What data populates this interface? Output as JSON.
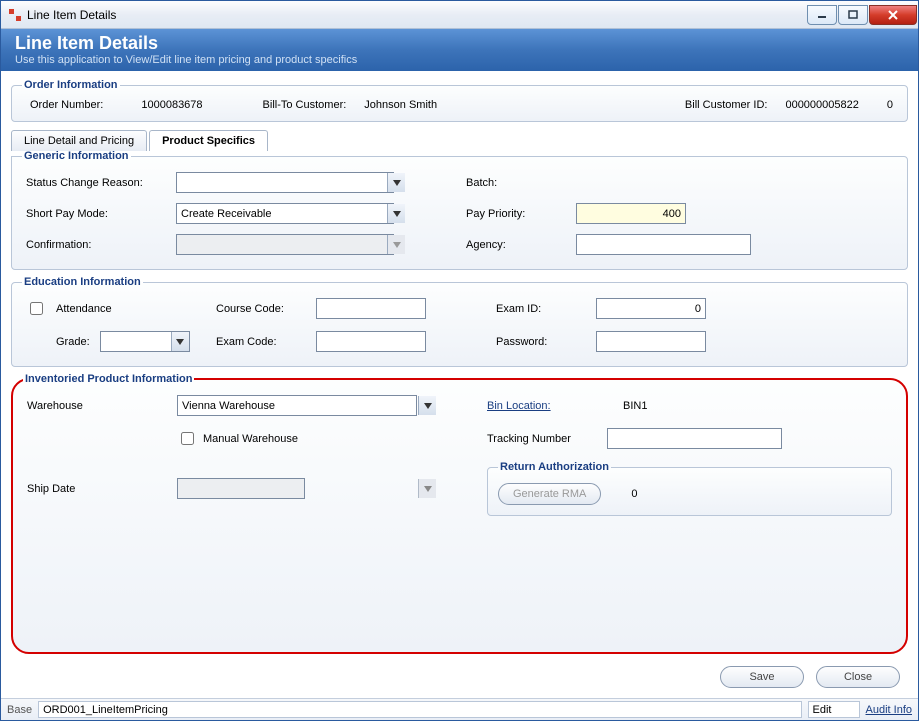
{
  "window": {
    "title": "Line Item Details"
  },
  "banner": {
    "title": "Line Item Details",
    "subtitle": "Use this application to View/Edit line item pricing and product specifics"
  },
  "order": {
    "legend": "Order Information",
    "order_number_label": "Order Number:",
    "order_number": "1000083678",
    "bill_to_label": "Bill-To Customer:",
    "bill_to": "Johnson Smith",
    "bill_customer_id_label": "Bill Customer ID:",
    "bill_customer_id": "000000005822",
    "bill_customer_sub": "0"
  },
  "tabs": {
    "line_detail": "Line Detail and Pricing",
    "product_specifics": "Product Specifics"
  },
  "generic": {
    "legend": "Generic Information",
    "status_change_reason_label": "Status Change Reason:",
    "status_change_reason": "",
    "short_pay_mode_label": "Short Pay Mode:",
    "short_pay_mode": "Create Receivable",
    "confirmation_label": "Confirmation:",
    "confirmation": "",
    "batch_label": "Batch:",
    "batch": "",
    "pay_priority_label": "Pay Priority:",
    "pay_priority": "400",
    "agency_label": "Agency:",
    "agency": ""
  },
  "education": {
    "legend": "Education Information",
    "attendance_label": "Attendance",
    "attendance": false,
    "grade_label": "Grade:",
    "grade": "",
    "course_code_label": "Course Code:",
    "course_code": "",
    "exam_code_label": "Exam Code:",
    "exam_code": "",
    "exam_id_label": "Exam ID:",
    "exam_id": "0",
    "password_label": "Password:",
    "password": ""
  },
  "inventory": {
    "legend": "Inventoried Product Information",
    "warehouse_label": "Warehouse",
    "warehouse": "Vienna Warehouse",
    "manual_warehouse_label": "Manual Warehouse",
    "manual_warehouse": false,
    "ship_date_label": "Ship Date",
    "ship_date": "",
    "bin_location_label": "Bin Location:",
    "bin_location": "BIN1",
    "tracking_number_label": "Tracking Number",
    "tracking_number": "",
    "return_auth_legend": "Return Authorization",
    "generate_rma_label": "Generate RMA",
    "rma_value": "0"
  },
  "buttons": {
    "save": "Save",
    "close": "Close"
  },
  "statusbar": {
    "base": "Base",
    "form_id": "ORD001_LineItemPricing",
    "edit": "Edit",
    "audit_info": "Audit Info"
  }
}
